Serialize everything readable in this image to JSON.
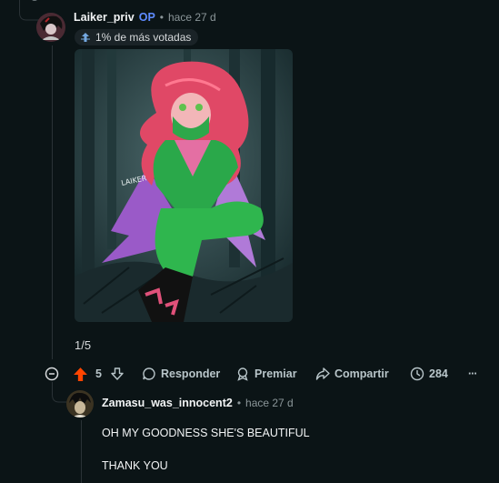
{
  "top_comment": {
    "username": "Laiker_priv",
    "op_tag": "OP",
    "separator": "•",
    "time": "hace 27 d",
    "badge_label": "1% de más votadas",
    "artwork_signature": "LAIKER",
    "pager": "1/5",
    "actions": {
      "score": "5",
      "reply": "Responder",
      "award": "Premiar",
      "share": "Compartir",
      "views": "284",
      "more": "···"
    }
  },
  "reply": {
    "username": "Zamasu_was_innocent2",
    "separator": "•",
    "time": "hace 27 d",
    "body_line1": "OH MY GOODNESS SHE'S BEAUTIFUL",
    "body_line2": "THANK YOU"
  },
  "colors": {
    "background": "#0b1416",
    "upvote_active": "#ff4500",
    "op_blue": "#5e8bff",
    "thread_line": "#2a3236"
  }
}
